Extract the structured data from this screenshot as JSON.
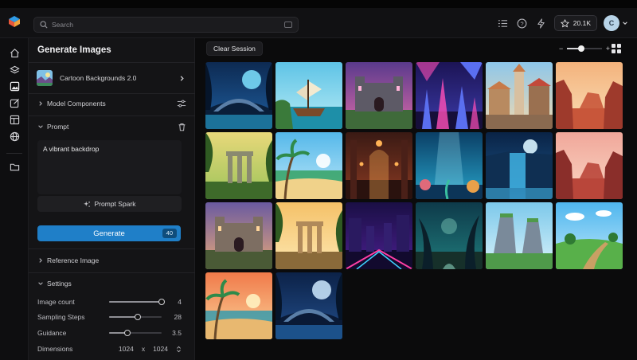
{
  "colors": {
    "accent": "#1f7fc8",
    "background": "#0b0b0c",
    "panel": "#141416"
  },
  "search": {
    "placeholder": "Search"
  },
  "header": {
    "credits": "20.1K",
    "avatar_initial": "C"
  },
  "rail": {
    "icons": [
      "home-icon",
      "layers-icon",
      "image-icon",
      "edit-icon",
      "template-icon",
      "globe-icon",
      "folder-icon"
    ]
  },
  "panel": {
    "title": "Generate Images",
    "model_name": "Cartoon Backgrounds 2.0",
    "model_components_label": "Model Components",
    "prompt_label": "Prompt",
    "prompt_text": "A vibrant backdrop",
    "prompt_spark_label": "Prompt Spark",
    "generate_label": "Generate",
    "generate_cost": "40",
    "reference_image_label": "Reference Image",
    "settings_label": "Settings",
    "settings": {
      "image_count": {
        "label": "Image count",
        "value": "4",
        "level": 1.0
      },
      "sampling_steps": {
        "label": "Sampling Steps",
        "value": "28",
        "level": 0.55
      },
      "guidance": {
        "label": "Guidance",
        "value": "3.5",
        "level": 0.35
      },
      "dimensions": {
        "label": "Dimensions",
        "width": "1024",
        "separator": "x",
        "height": "1024"
      }
    }
  },
  "main": {
    "clear_session_label": "Clear Session",
    "zoom_minus": "−",
    "zoom_plus": "+",
    "zoom_level": 0.4,
    "images": [
      "night-arch-bridge",
      "pirate-ship-cove",
      "ruined-fortress-twilight",
      "crystal-cave-neon",
      "market-street-town",
      "red-desert-canyon",
      "jungle-temple-ruins",
      "tropical-beach-palms",
      "gothic-hall-interior",
      "underwater-reef-light",
      "moonlit-waterfall",
      "red-rock-mesa",
      "stone-castle-gate",
      "sunlit-ancient-ruins",
      "neon-city-street",
      "twisted-forest-path",
      "green-cliffs-valley",
      "meadow-dirt-path",
      "sunset-beach-clouds",
      "moonlit-blue-bridge"
    ]
  }
}
